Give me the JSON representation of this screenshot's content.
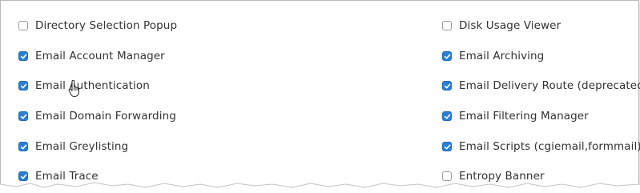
{
  "features": {
    "left": [
      {
        "label": "Directory Selection Popup",
        "checked": false
      },
      {
        "label": "Email Account Manager",
        "checked": true
      },
      {
        "label": "Email Authentication",
        "checked": true
      },
      {
        "label": "Email Domain Forwarding",
        "checked": true
      },
      {
        "label": "Email Greylisting",
        "checked": true
      },
      {
        "label": "Email Trace",
        "checked": true
      }
    ],
    "right": [
      {
        "label": "Disk Usage Viewer",
        "checked": false
      },
      {
        "label": "Email Archiving",
        "checked": true
      },
      {
        "label": "Email Delivery Route (deprecated)",
        "checked": true
      },
      {
        "label": "Email Filtering Manager",
        "checked": true
      },
      {
        "label": "Email Scripts (cgiemail,formmail)",
        "checked": true
      },
      {
        "label": "Entropy Banner",
        "checked": false
      }
    ]
  },
  "icons": {
    "checkmark": "checkmark-icon",
    "pointer": "hand-pointer-cursor-icon"
  },
  "colors": {
    "checkbox_checked": "#2a7fd4",
    "checkbox_border": "#9a9a9a",
    "label_text": "#333333"
  }
}
